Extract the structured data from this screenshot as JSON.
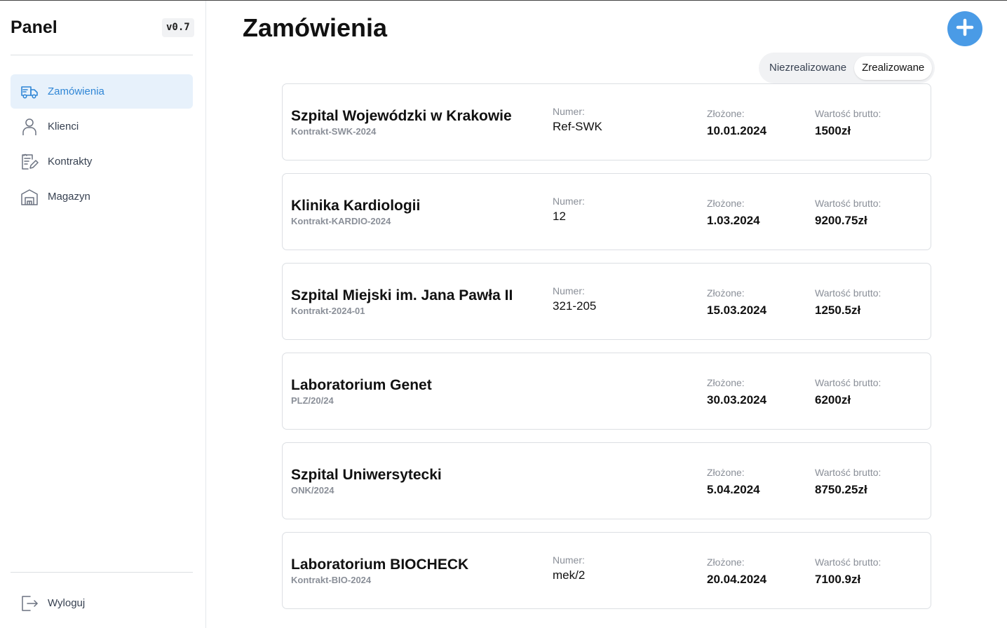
{
  "sidebar": {
    "brand": "Panel",
    "version": "v0.7",
    "items": [
      {
        "label": "Zamówienia",
        "icon": "truck-icon",
        "active": true
      },
      {
        "label": "Klienci",
        "icon": "user-icon",
        "active": false
      },
      {
        "label": "Kontrakty",
        "icon": "contract-icon",
        "active": false
      },
      {
        "label": "Magazyn",
        "icon": "warehouse-icon",
        "active": false
      }
    ],
    "logout": {
      "label": "Wyloguj",
      "icon": "logout-icon"
    }
  },
  "header": {
    "title": "Zamówienia",
    "add_icon": "plus-icon"
  },
  "filter": {
    "options": [
      "Niezrealizowane",
      "Zrealizowane"
    ],
    "selected": "Zrealizowane"
  },
  "labels": {
    "number": "Numer:",
    "placed": "Złożone:",
    "gross": "Wartość brutto:"
  },
  "orders": [
    {
      "client": "Szpital Wojewódzki w Krakowie",
      "contract": "Kontrakt-SWK-2024",
      "number": "Ref-SWK",
      "date": "10.01.2024",
      "gross": "1500zł"
    },
    {
      "client": "Klinika Kardiologii",
      "contract": "Kontrakt-KARDIO-2024",
      "number": "12",
      "date": "1.03.2024",
      "gross": "9200.75zł"
    },
    {
      "client": "Szpital Miejski im. Jana Pawła II",
      "contract": "Kontrakt-2024-01",
      "number": "321-205",
      "date": "15.03.2024",
      "gross": "1250.5zł"
    },
    {
      "client": "Laboratorium Genet",
      "contract": "PLZ/20/24",
      "number": "",
      "date": "30.03.2024",
      "gross": "6200zł"
    },
    {
      "client": "Szpital Uniwersytecki",
      "contract": "ONK/2024",
      "number": "",
      "date": "5.04.2024",
      "gross": "8750.25zł"
    },
    {
      "client": "Laboratorium BIOCHECK",
      "contract": "Kontrakt-BIO-2024",
      "number": "mek/2",
      "date": "20.04.2024",
      "gross": "7100.9zł"
    }
  ],
  "colors": {
    "accent": "#2f86d6",
    "accent_button": "#4a9be6",
    "active_bg": "#e7f1fb"
  }
}
